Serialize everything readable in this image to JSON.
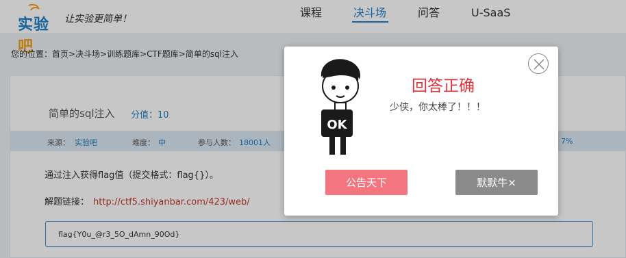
{
  "brand": {
    "logo_main": "实验",
    "logo_accent": "吧",
    "slogan": "让实验更简单！"
  },
  "nav": {
    "items": [
      "课程",
      "决斗场",
      "问答",
      "U-SaaS"
    ],
    "active": "决斗场"
  },
  "breadcrumb": "您的位置：首页>决斗场>训练题库>CTF题库>简单的sql注入",
  "problem": {
    "title": "简单的sql注入",
    "score_label": "分值：",
    "score_value": "10",
    "source_label": "来源：",
    "source_value": "实验吧",
    "difficulty_label": "难度：",
    "difficulty_value": "中",
    "participants_label": "参与人数：",
    "participants_value": "18001人",
    "rate_partial": "7%",
    "description": "通过注入获得flag值（提交格式：flag{}）。",
    "link_label": "解题链接：",
    "link_url": "http://ctf5.shiyanbar.com/423/web/",
    "answer_value": "flag{Y0u_@r3_5O_dAmn_90Od}"
  },
  "modal": {
    "title": "回答正确",
    "message": "少侠，你太棒了！！！",
    "share_button": "公告天下",
    "silent_button": "默默牛×",
    "mascot_sign": "OK"
  },
  "colors": {
    "accent": "#1e7fc8",
    "success_title": "#e0303a",
    "share": "#f2757f",
    "silent": "#8a8a8a"
  }
}
